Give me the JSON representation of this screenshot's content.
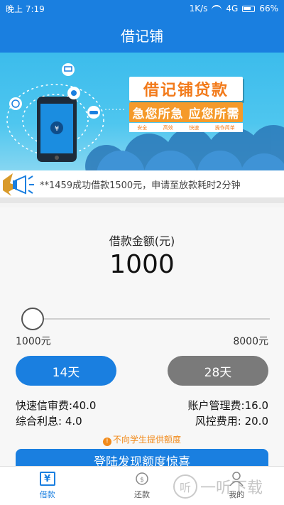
{
  "status_bar": {
    "time": "晚上 7:19",
    "network_speed": "1K/s",
    "signal": "4G",
    "battery": "66%"
  },
  "header": {
    "title": "借记铺"
  },
  "banner": {
    "title": "借记铺贷款",
    "slogan": "急您所急 应您所需",
    "tags": [
      "安全",
      "高效",
      "快速",
      "操作简单"
    ]
  },
  "notice": {
    "text": "**1459成功借款1500元，申请至放款耗时2分钟"
  },
  "loan": {
    "amount_label": "借款金额(元)",
    "amount_value": "1000",
    "slider_min_label": "1000元",
    "slider_max_label": "8000元",
    "slider_position": 0.0,
    "term_14_label": "14天",
    "term_28_label": "28天",
    "selected_term": "14天",
    "fee_left_1": "快速信审费:40.0",
    "fee_left_2": "综合利息: 4.0",
    "fee_right_1": "账户管理费:16.0",
    "fee_right_2": "风控费用: 20.0",
    "warning": "不向学生提供额度",
    "cta_label": "登陆发现额度惊喜"
  },
  "tabbar": {
    "items": [
      {
        "label": "借款",
        "icon": "yen-icon",
        "active": true
      },
      {
        "label": "还款",
        "icon": "repay-icon",
        "active": false
      },
      {
        "label": "我的",
        "icon": "user-icon",
        "active": false
      }
    ]
  },
  "watermark": {
    "text": "一听下载",
    "circle_char": "听"
  },
  "colors": {
    "primary": "#1a7fe0",
    "inactive_button": "#7a7a7a",
    "warning": "#f28a1a"
  }
}
